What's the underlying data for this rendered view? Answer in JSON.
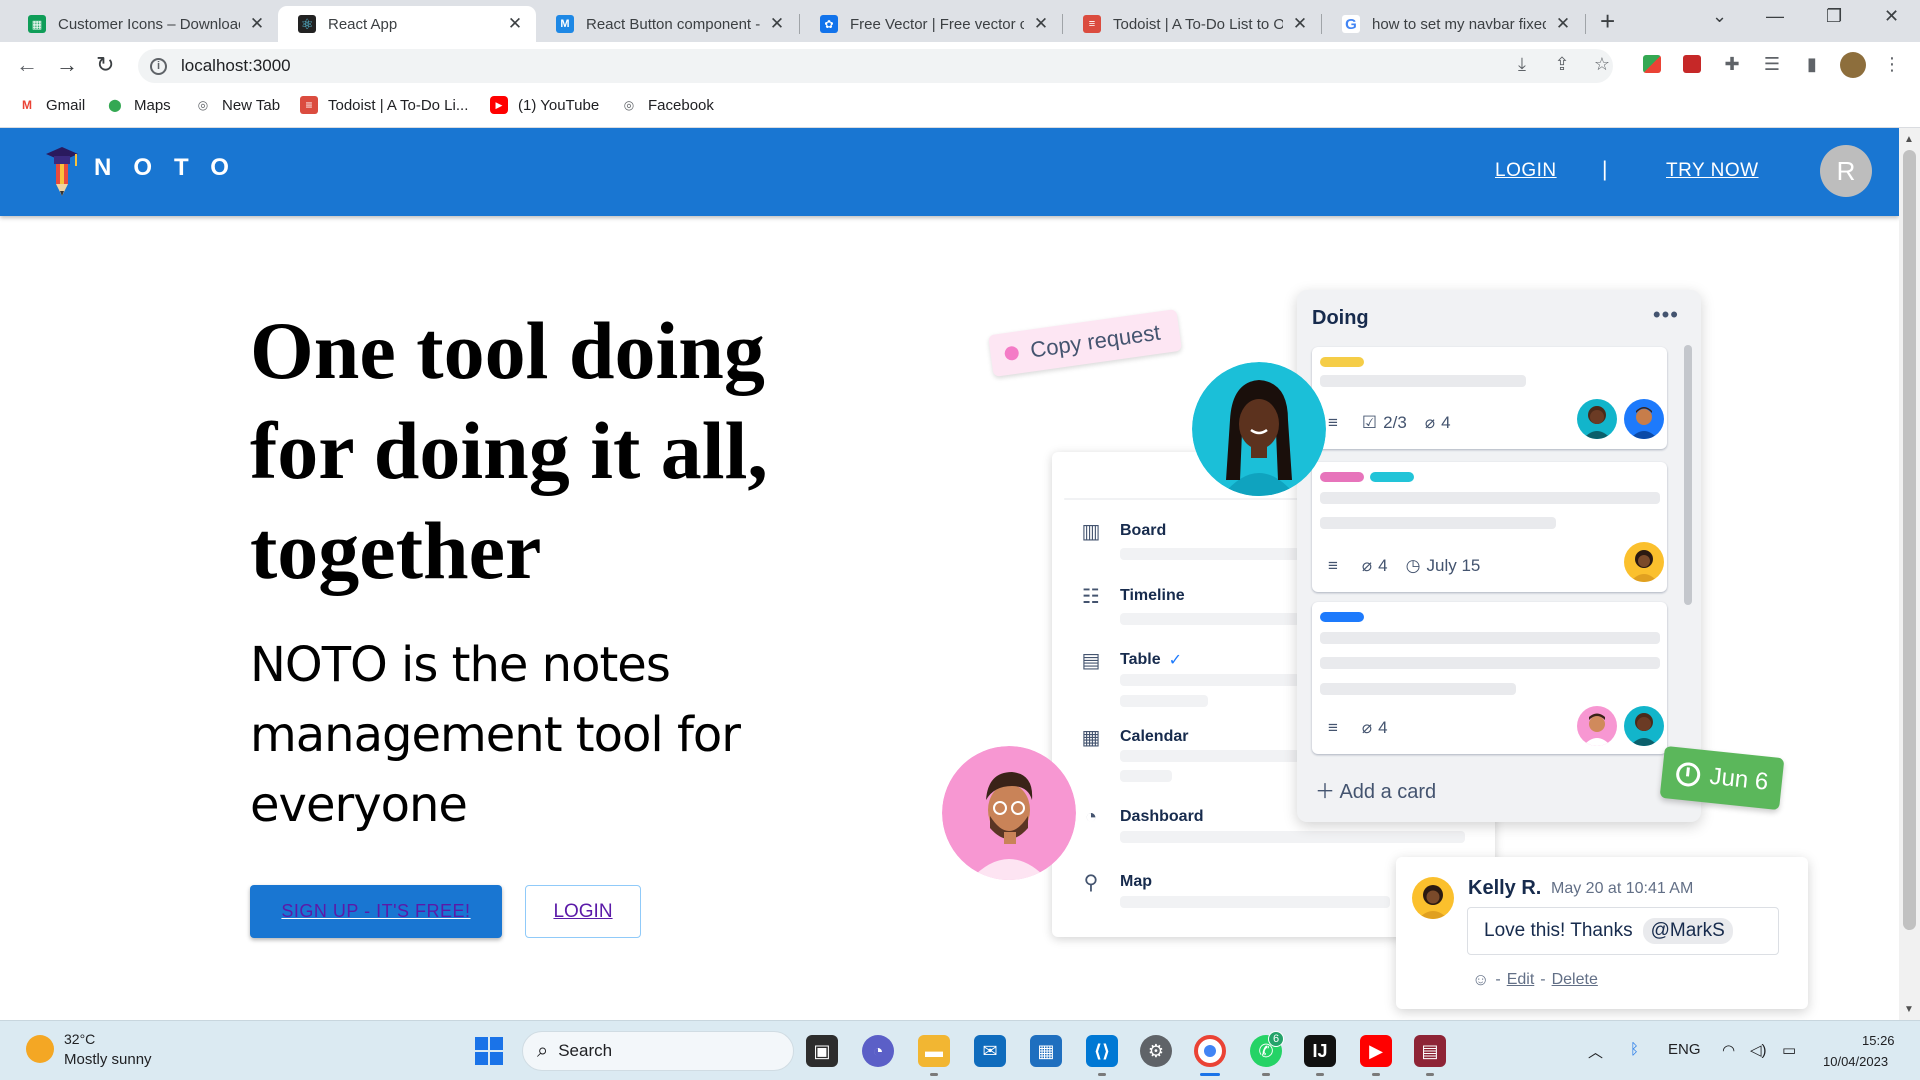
{
  "browser": {
    "tabs": [
      {
        "label": "Customer Icons – Download",
        "favicon": "sheets-icon",
        "color": "#0f9d58"
      },
      {
        "label": "React App",
        "favicon": "react-icon",
        "color": "#222222"
      },
      {
        "label": "React Button component - M",
        "favicon": "mui-icon",
        "color": "#1e88e5"
      },
      {
        "label": "Free Vector | Free vector co",
        "favicon": "freepik-icon",
        "color": "#1273eb"
      },
      {
        "label": "Todoist | A To-Do List to Or",
        "favicon": "todoist-icon",
        "color": "#db4c3f"
      },
      {
        "label": "how to set my navbar fixed",
        "favicon": "google-icon",
        "color": "#4285f4"
      }
    ],
    "url": "localhost:3000",
    "bookmarks": [
      {
        "label": "Gmail",
        "icon": "gmail-icon",
        "color": "#ea4335"
      },
      {
        "label": "Maps",
        "icon": "maps-icon",
        "color": "#34a853"
      },
      {
        "label": "New Tab",
        "icon": "globe-icon",
        "color": "#5f6368"
      },
      {
        "label": "Todoist | A To-Do Li...",
        "icon": "todoist-icon",
        "color": "#db4c3f"
      },
      {
        "label": "(1) YouTube",
        "icon": "youtube-icon",
        "color": "#ff0000"
      },
      {
        "label": "Facebook",
        "icon": "globe-icon",
        "color": "#5f6368"
      }
    ]
  },
  "navbar": {
    "brand": "NOTO",
    "login": "LOGIN",
    "separator": "|",
    "try_now": "TRY NOW",
    "avatar_initial": "R",
    "color": "#1976d2"
  },
  "hero": {
    "title": "One tool doing for doing it all, together",
    "subtitle": "NOTO is the notes management tool for everyone",
    "signup": "SIGN UP - IT'S FREE!",
    "login": "LOGIN"
  },
  "illustration": {
    "copy_request": "Copy request",
    "column_title": "Doing",
    "cards": [
      {
        "checklist": "2/3",
        "attachments": "4"
      },
      {
        "attachments": "4",
        "due": "July 15"
      },
      {
        "attachments": "4"
      }
    ],
    "add_card": "Add a card",
    "badge": "Jun 6",
    "views": [
      "Board",
      "Timeline",
      "Table",
      "Calendar",
      "Dashboard",
      "Map"
    ],
    "comment": {
      "author": "Kelly R.",
      "time": "May 20 at 10:41 AM",
      "text": "Love this! Thanks",
      "mention": "@MarkS",
      "edit": "Edit",
      "delete": "Delete"
    }
  },
  "taskbar": {
    "temperature": "32°C",
    "weather": "Mostly sunny",
    "search": "Search",
    "language": "ENG",
    "time": "15:26",
    "date": "10/04/2023",
    "whatsapp_badge": "6"
  }
}
